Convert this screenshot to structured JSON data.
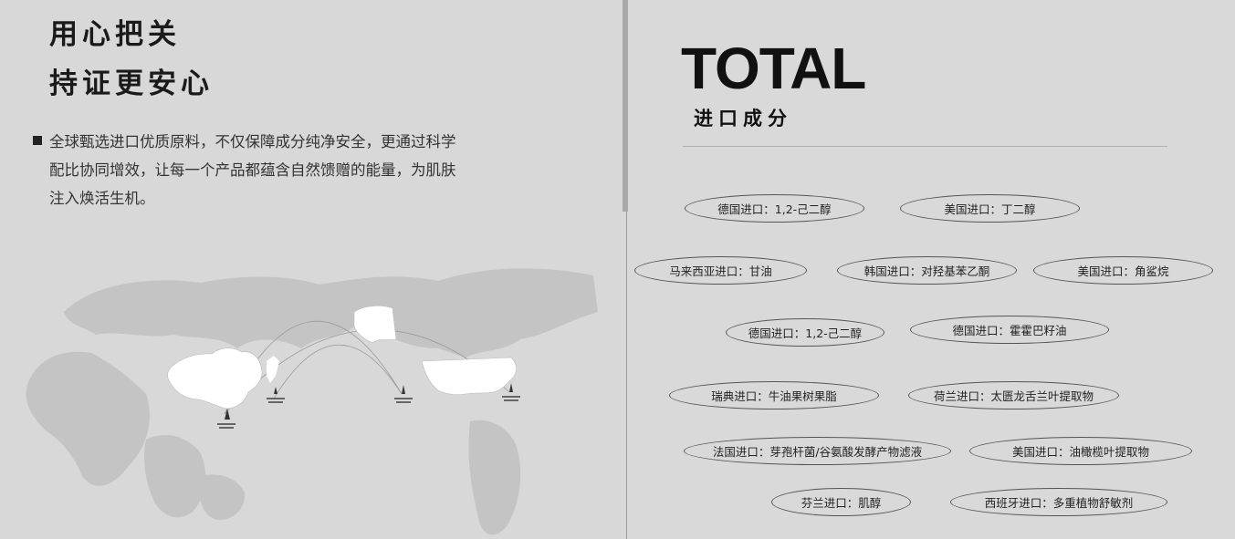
{
  "left": {
    "headline_1": "用心把关",
    "headline_2": "持证更安心",
    "body": "全球甄选进口优质原料，不仅保障成分纯净安全，更通过科学配比协同增效，让每一个产品都蕴含自然馈赠的能量，为肌肤注入焕活生机。"
  },
  "right": {
    "title": "TOTAL",
    "subtitle": "进口成分",
    "ingredients": [
      "德国进口：1,2-己二醇",
      "美国进口：丁二醇",
      "马来西亚进口：甘油",
      "韩国进口：对羟基苯乙酮",
      "美国进口：角鲨烷",
      "德国进口：1,2-己二醇",
      "德国进口：霍霍巴籽油",
      "瑞典进口：牛油果树果脂",
      "荷兰进口：太匮龙舌兰叶提取物",
      "法国进口：芽孢杆菌/谷氨酸发酵产物滤液",
      "美国进口：油橄榄叶提取物",
      "芬兰进口：肌醇",
      "西班牙进口：多重植物舒敏剂"
    ]
  },
  "colors": {
    "background": "#d9d9d9",
    "text": "#222222",
    "pill_border": "#555555"
  }
}
